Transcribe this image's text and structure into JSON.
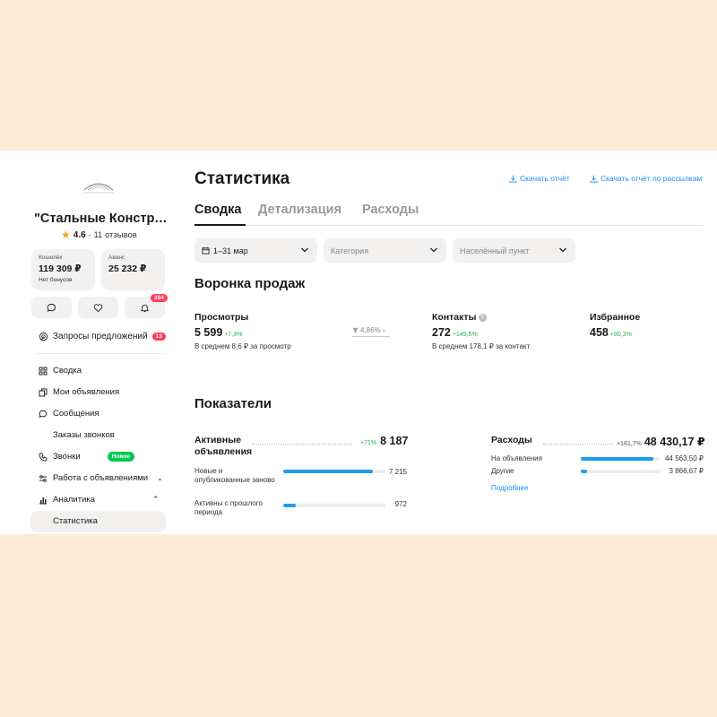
{
  "sidebar": {
    "company_name": "\"Стальные Конструкции\"",
    "rating": "4.6",
    "reviews": "· 11 отзывов",
    "wallet": {
      "label": "Кошелёк",
      "amount": "119 309 ₽",
      "sub": "Нет бонусов"
    },
    "advance": {
      "label": "Аванс",
      "amount": "25 232 ₽"
    },
    "notifications_badge": "284",
    "requests": {
      "label": "Запросы предложений",
      "badge": "13"
    },
    "nav": [
      {
        "label": "Сводка",
        "icon": "grid-icon"
      },
      {
        "label": "Мои объявления",
        "icon": "copy-icon"
      },
      {
        "label": "Сообщения",
        "icon": "chat-icon"
      },
      {
        "label": "Заказы звонков",
        "icon": ""
      },
      {
        "label": "Звонки",
        "icon": "phone-icon",
        "badge": "Новое"
      },
      {
        "label": "Работа с объявлениями",
        "icon": "sliders-icon"
      },
      {
        "label": "Аналитика",
        "icon": "bar-chart-icon"
      }
    ],
    "active_item": "Статистика"
  },
  "header": {
    "title": "Статистика",
    "download_report": "Скачать отчёт",
    "download_mailing": "Скачать отчёт по рассылкам"
  },
  "tabs": [
    "Сводка",
    "Детализация",
    "Расходы"
  ],
  "filters": {
    "period": "1–31 мар",
    "category": "Категория",
    "location": "Населённый пункт"
  },
  "funnel": {
    "title": "Воронка продаж",
    "views": {
      "label": "Просмотры",
      "value": "5 599",
      "delta": "+7,3%",
      "sub": "В среднем 8,6 ₽ за просмотр"
    },
    "conversion": "4,86%",
    "contacts": {
      "label": "Контакты",
      "value": "272",
      "delta": "+149,5%",
      "sub": "В среднем 178,1 ₽ за контакт"
    },
    "favorites": {
      "label": "Избранное",
      "value": "458",
      "delta": "+80,3%"
    }
  },
  "indicators": {
    "title": "Показатели",
    "active": {
      "label": "Активные объявления",
      "delta": "+71%",
      "value": "8 187",
      "rows": [
        {
          "label": "Новые и опубликованные заново",
          "value": "7 215",
          "fraction": 0.88
        },
        {
          "label": "Активны с прошлого периода",
          "value": "972",
          "fraction": 0.12
        }
      ]
    },
    "expenses": {
      "label": "Расходы",
      "delta": "+161,7%",
      "value": "48 430,17 ₽",
      "rows": [
        {
          "label": "На объявления",
          "value": "44 563,50 ₽",
          "fraction": 0.92
        },
        {
          "label": "Другие",
          "value": "3 866,67 ₽",
          "fraction": 0.08
        }
      ],
      "link": "Подробнее"
    }
  },
  "colors": {
    "accent": "#1a8cff",
    "bar": "#1a9df0",
    "positive": "#22b14c",
    "badge": "#ff3b5c",
    "new": "#00c853"
  }
}
